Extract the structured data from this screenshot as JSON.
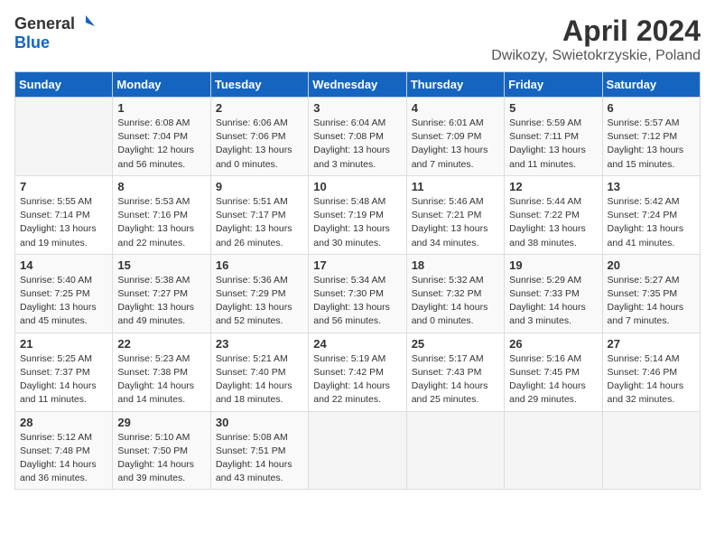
{
  "header": {
    "logo_general": "General",
    "logo_blue": "Blue",
    "title": "April 2024",
    "subtitle": "Dwikozy, Swietokrzyskie, Poland"
  },
  "days_of_week": [
    "Sunday",
    "Monday",
    "Tuesday",
    "Wednesday",
    "Thursday",
    "Friday",
    "Saturday"
  ],
  "weeks": [
    [
      {
        "day": "",
        "sunrise": "",
        "sunset": "",
        "daylight": ""
      },
      {
        "day": "1",
        "sunrise": "Sunrise: 6:08 AM",
        "sunset": "Sunset: 7:04 PM",
        "daylight": "Daylight: 12 hours and 56 minutes."
      },
      {
        "day": "2",
        "sunrise": "Sunrise: 6:06 AM",
        "sunset": "Sunset: 7:06 PM",
        "daylight": "Daylight: 13 hours and 0 minutes."
      },
      {
        "day": "3",
        "sunrise": "Sunrise: 6:04 AM",
        "sunset": "Sunset: 7:08 PM",
        "daylight": "Daylight: 13 hours and 3 minutes."
      },
      {
        "day": "4",
        "sunrise": "Sunrise: 6:01 AM",
        "sunset": "Sunset: 7:09 PM",
        "daylight": "Daylight: 13 hours and 7 minutes."
      },
      {
        "day": "5",
        "sunrise": "Sunrise: 5:59 AM",
        "sunset": "Sunset: 7:11 PM",
        "daylight": "Daylight: 13 hours and 11 minutes."
      },
      {
        "day": "6",
        "sunrise": "Sunrise: 5:57 AM",
        "sunset": "Sunset: 7:12 PM",
        "daylight": "Daylight: 13 hours and 15 minutes."
      }
    ],
    [
      {
        "day": "7",
        "sunrise": "Sunrise: 5:55 AM",
        "sunset": "Sunset: 7:14 PM",
        "daylight": "Daylight: 13 hours and 19 minutes."
      },
      {
        "day": "8",
        "sunrise": "Sunrise: 5:53 AM",
        "sunset": "Sunset: 7:16 PM",
        "daylight": "Daylight: 13 hours and 22 minutes."
      },
      {
        "day": "9",
        "sunrise": "Sunrise: 5:51 AM",
        "sunset": "Sunset: 7:17 PM",
        "daylight": "Daylight: 13 hours and 26 minutes."
      },
      {
        "day": "10",
        "sunrise": "Sunrise: 5:48 AM",
        "sunset": "Sunset: 7:19 PM",
        "daylight": "Daylight: 13 hours and 30 minutes."
      },
      {
        "day": "11",
        "sunrise": "Sunrise: 5:46 AM",
        "sunset": "Sunset: 7:21 PM",
        "daylight": "Daylight: 13 hours and 34 minutes."
      },
      {
        "day": "12",
        "sunrise": "Sunrise: 5:44 AM",
        "sunset": "Sunset: 7:22 PM",
        "daylight": "Daylight: 13 hours and 38 minutes."
      },
      {
        "day": "13",
        "sunrise": "Sunrise: 5:42 AM",
        "sunset": "Sunset: 7:24 PM",
        "daylight": "Daylight: 13 hours and 41 minutes."
      }
    ],
    [
      {
        "day": "14",
        "sunrise": "Sunrise: 5:40 AM",
        "sunset": "Sunset: 7:25 PM",
        "daylight": "Daylight: 13 hours and 45 minutes."
      },
      {
        "day": "15",
        "sunrise": "Sunrise: 5:38 AM",
        "sunset": "Sunset: 7:27 PM",
        "daylight": "Daylight: 13 hours and 49 minutes."
      },
      {
        "day": "16",
        "sunrise": "Sunrise: 5:36 AM",
        "sunset": "Sunset: 7:29 PM",
        "daylight": "Daylight: 13 hours and 52 minutes."
      },
      {
        "day": "17",
        "sunrise": "Sunrise: 5:34 AM",
        "sunset": "Sunset: 7:30 PM",
        "daylight": "Daylight: 13 hours and 56 minutes."
      },
      {
        "day": "18",
        "sunrise": "Sunrise: 5:32 AM",
        "sunset": "Sunset: 7:32 PM",
        "daylight": "Daylight: 14 hours and 0 minutes."
      },
      {
        "day": "19",
        "sunrise": "Sunrise: 5:29 AM",
        "sunset": "Sunset: 7:33 PM",
        "daylight": "Daylight: 14 hours and 3 minutes."
      },
      {
        "day": "20",
        "sunrise": "Sunrise: 5:27 AM",
        "sunset": "Sunset: 7:35 PM",
        "daylight": "Daylight: 14 hours and 7 minutes."
      }
    ],
    [
      {
        "day": "21",
        "sunrise": "Sunrise: 5:25 AM",
        "sunset": "Sunset: 7:37 PM",
        "daylight": "Daylight: 14 hours and 11 minutes."
      },
      {
        "day": "22",
        "sunrise": "Sunrise: 5:23 AM",
        "sunset": "Sunset: 7:38 PM",
        "daylight": "Daylight: 14 hours and 14 minutes."
      },
      {
        "day": "23",
        "sunrise": "Sunrise: 5:21 AM",
        "sunset": "Sunset: 7:40 PM",
        "daylight": "Daylight: 14 hours and 18 minutes."
      },
      {
        "day": "24",
        "sunrise": "Sunrise: 5:19 AM",
        "sunset": "Sunset: 7:42 PM",
        "daylight": "Daylight: 14 hours and 22 minutes."
      },
      {
        "day": "25",
        "sunrise": "Sunrise: 5:17 AM",
        "sunset": "Sunset: 7:43 PM",
        "daylight": "Daylight: 14 hours and 25 minutes."
      },
      {
        "day": "26",
        "sunrise": "Sunrise: 5:16 AM",
        "sunset": "Sunset: 7:45 PM",
        "daylight": "Daylight: 14 hours and 29 minutes."
      },
      {
        "day": "27",
        "sunrise": "Sunrise: 5:14 AM",
        "sunset": "Sunset: 7:46 PM",
        "daylight": "Daylight: 14 hours and 32 minutes."
      }
    ],
    [
      {
        "day": "28",
        "sunrise": "Sunrise: 5:12 AM",
        "sunset": "Sunset: 7:48 PM",
        "daylight": "Daylight: 14 hours and 36 minutes."
      },
      {
        "day": "29",
        "sunrise": "Sunrise: 5:10 AM",
        "sunset": "Sunset: 7:50 PM",
        "daylight": "Daylight: 14 hours and 39 minutes."
      },
      {
        "day": "30",
        "sunrise": "Sunrise: 5:08 AM",
        "sunset": "Sunset: 7:51 PM",
        "daylight": "Daylight: 14 hours and 43 minutes."
      },
      {
        "day": "",
        "sunrise": "",
        "sunset": "",
        "daylight": ""
      },
      {
        "day": "",
        "sunrise": "",
        "sunset": "",
        "daylight": ""
      },
      {
        "day": "",
        "sunrise": "",
        "sunset": "",
        "daylight": ""
      },
      {
        "day": "",
        "sunrise": "",
        "sunset": "",
        "daylight": ""
      }
    ]
  ]
}
